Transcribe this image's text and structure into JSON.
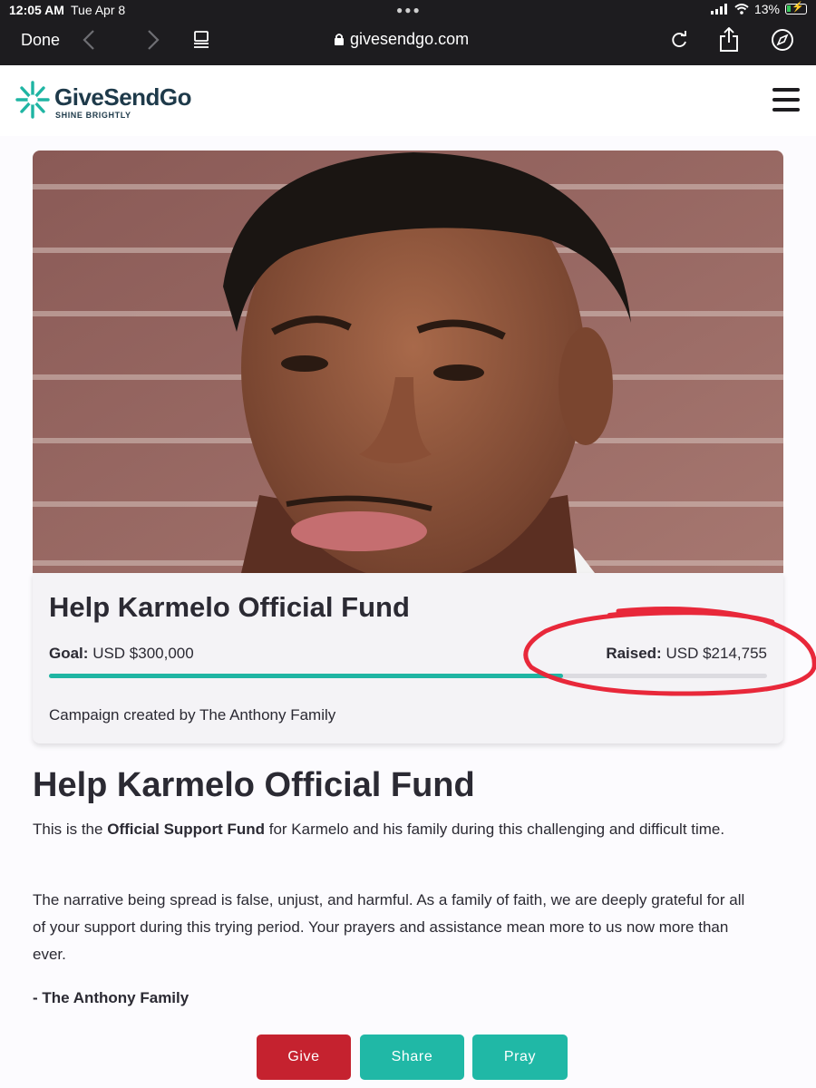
{
  "status_bar": {
    "time": "12:05 AM",
    "date": "Tue Apr 8",
    "battery": "13%"
  },
  "browser": {
    "done_label": "Done",
    "url": "givesendgo.com"
  },
  "site": {
    "brand_name": "GiveSendGo",
    "tagline": "SHINE BRIGHTLY"
  },
  "campaign": {
    "title": "Help Karmelo Official Fund",
    "goal_label": "Goal:",
    "goal_value": "USD $300,000",
    "raised_label": "Raised:",
    "raised_value": "USD $214,755",
    "progress_fraction": 0.7159,
    "creator_prefix": "Campaign created by",
    "creator_name": "The Anthony Family"
  },
  "description": {
    "title": "Help Karmelo Official Fund",
    "p1_prefix": "This is the",
    "p1_bold": "Official Support Fund",
    "p1_suffix": "for Karmelo and his family during this challenging and difficult time.",
    "p2": "The narrative being spread is false, unjust, and harmful. As a family of faith, we are deeply grateful for all of your support during this trying period. Your prayers and assistance mean more to us now more than ever.",
    "signature": "- The Anthony Family"
  },
  "actions": {
    "give": "Give",
    "share": "Share",
    "pray": "Pray"
  },
  "colors": {
    "teal": "#20b8a6",
    "give_red": "#c5222f",
    "annotation_red": "#e8283a",
    "brand_navy": "#1e3a4a"
  }
}
